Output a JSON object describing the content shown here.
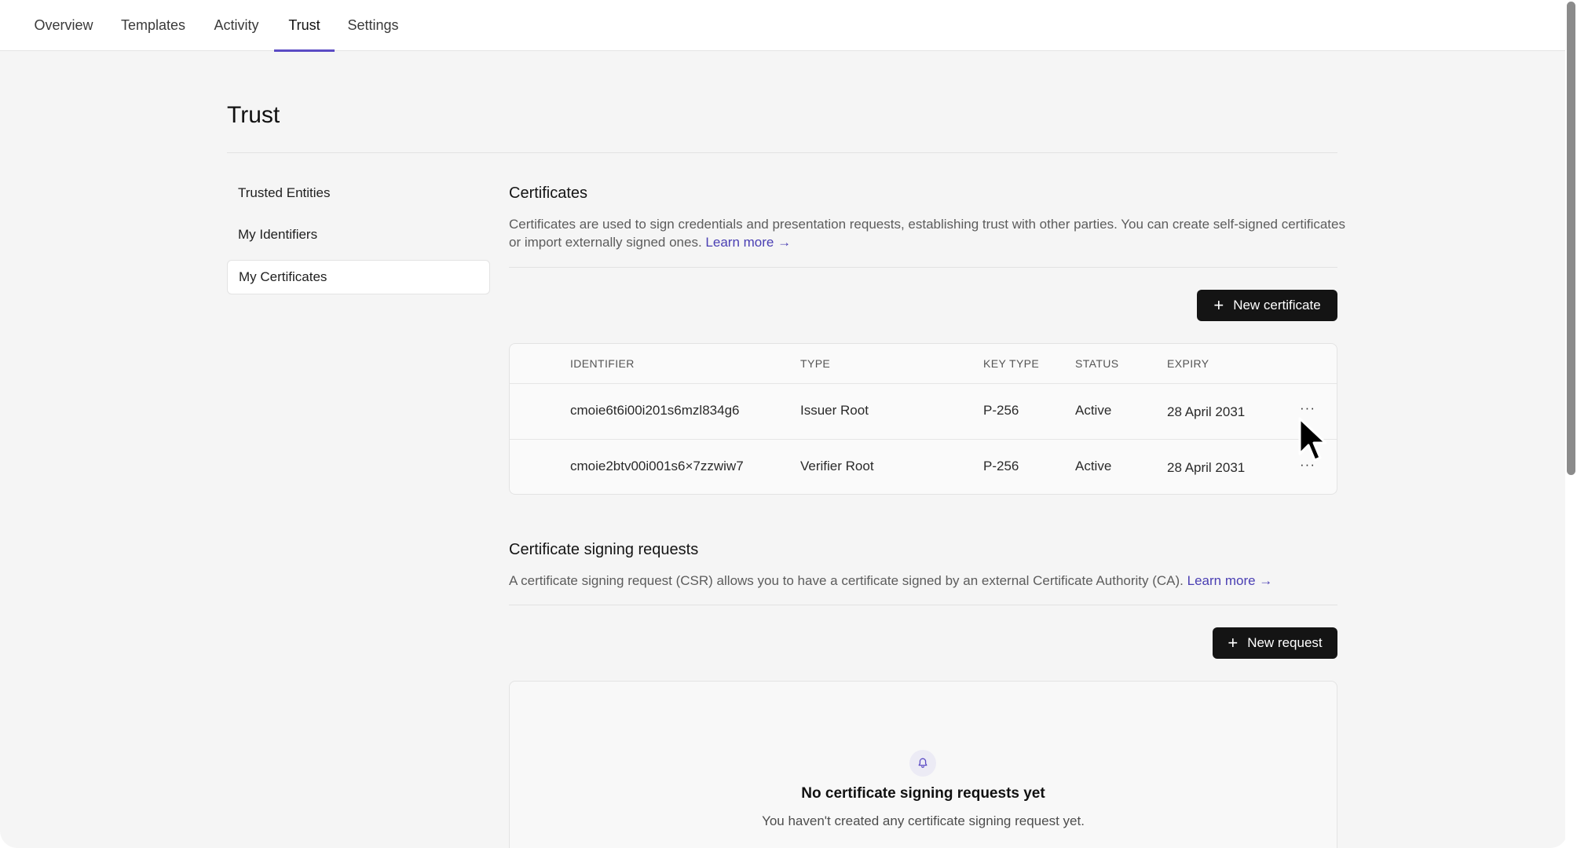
{
  "tabs": [
    {
      "label": "Overview"
    },
    {
      "label": "Templates"
    },
    {
      "label": "Activity"
    },
    {
      "label": "Trust"
    },
    {
      "label": "Settings"
    }
  ],
  "active_tab": "Trust",
  "page": {
    "title": "Trust"
  },
  "sidebar": {
    "items": [
      {
        "label": "Trusted Entities"
      },
      {
        "label": "My Identifiers"
      },
      {
        "label": "My Certificates"
      }
    ],
    "active": "My Certificates"
  },
  "certificates": {
    "title": "Certificates",
    "description": "Certificates are used to sign credentials and presentation requests, establishing trust with other parties. You can create self-signed certificates or import externally signed ones.",
    "learn_more": "Learn more →",
    "new_button": "New certificate",
    "columns": [
      "IDENTIFIER",
      "TYPE",
      "KEY TYPE",
      "STATUS",
      "EXPIRY"
    ],
    "rows": [
      {
        "identifier": "cmoie6t6i00i201s6mzl834g6",
        "type": "Issuer Root",
        "key_type": "P-256",
        "status": "Active",
        "expiry": "28 April 2031",
        "more": "···"
      },
      {
        "identifier": "cmoie2btv00i001s6×7zzwiw7",
        "type": "Verifier Root",
        "key_type": "P-256",
        "status": "Active",
        "expiry": "28 April 2031",
        "more": "···"
      }
    ]
  },
  "csr": {
    "title": "Certificate signing requests",
    "description": "A certificate signing request (CSR) allows you to have a certificate signed by an external Certificate Authority (CA).",
    "learn_more": "Learn more →",
    "new_button": "New request",
    "empty_title": "No certificate signing requests yet",
    "empty_subtitle": "You haven't created any certificate signing request yet.",
    "empty_icon": "bell-icon"
  },
  "colors": {
    "accent": "#5b4bc4",
    "link": "#4a3fb3",
    "button_bg": "#141414",
    "page_bg": "#f5f5f5"
  }
}
